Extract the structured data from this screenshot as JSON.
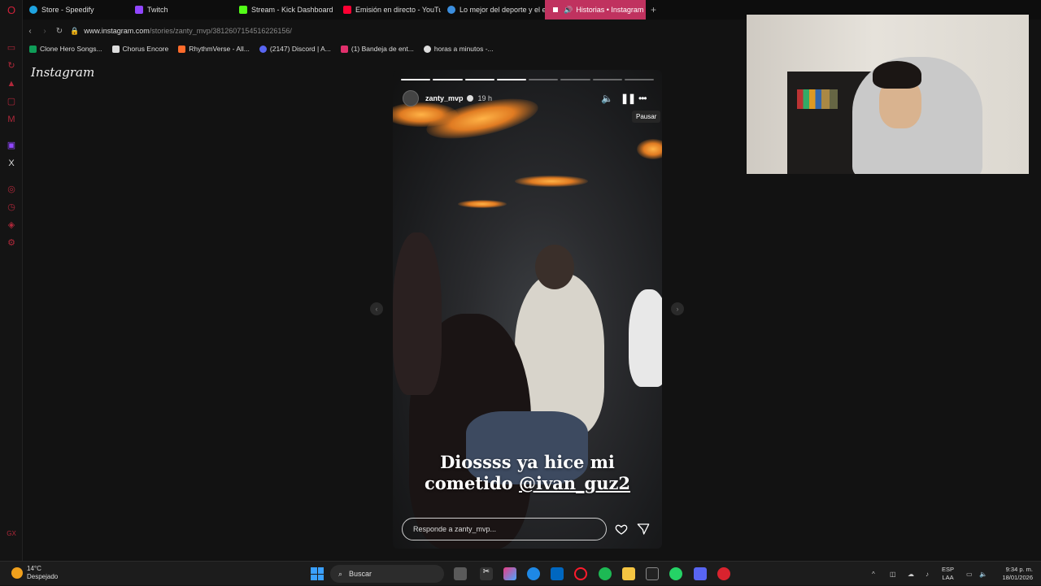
{
  "browser": {
    "tabs": [
      {
        "label": "Store - Speedify",
        "color": "#1ea3e0"
      },
      {
        "label": "Twitch",
        "color": "#9146ff"
      },
      {
        "label": "Stream - Kick Dashboard",
        "color": "#53fc18"
      },
      {
        "label": "Emisión en directo - YouTu",
        "color": "#ff0033"
      },
      {
        "label": "Lo mejor del deporte y el e",
        "color": "#3b8ede"
      },
      {
        "label": "Historias • Instagram",
        "color": "#e1306c"
      }
    ],
    "active_tab_index": 5,
    "url_host": "www.instagram.com",
    "url_path": "/stories/zanty_mvp/3812607154516226156/",
    "bookmarks": [
      {
        "label": "Clone Hero Songs...",
        "color": "#0f9d58"
      },
      {
        "label": "Chorus Encore",
        "color": "#dddddd"
      },
      {
        "label": "RhythmVerse - All...",
        "color": "#ff6b2b"
      },
      {
        "label": "(2147) Discord | A...",
        "color": "#5865f2"
      },
      {
        "label": "(1) Bandeja de ent...",
        "color": "#e1306c"
      },
      {
        "label": "horas a minutos -...",
        "color": "#dddddd"
      }
    ]
  },
  "page": {
    "logo": "Instagram"
  },
  "story": {
    "username": "zanty_mvp",
    "time": "19 h",
    "progress_segments": 8,
    "progress_done": 4,
    "tooltip": "Pausar",
    "caption_line1": "Diossss ya hice mi",
    "caption_prefix": "cometido ",
    "caption_mention": "@ivan_guz2",
    "reply_placeholder": "Responde a zanty_mvp..."
  },
  "taskbar": {
    "temperature": "14°C",
    "weather": "Despejado",
    "search_label": "Buscar",
    "lang_line1": "ESP",
    "lang_line2": "LAA",
    "time": "9:34 p. m.",
    "date": "18/01/2026"
  }
}
